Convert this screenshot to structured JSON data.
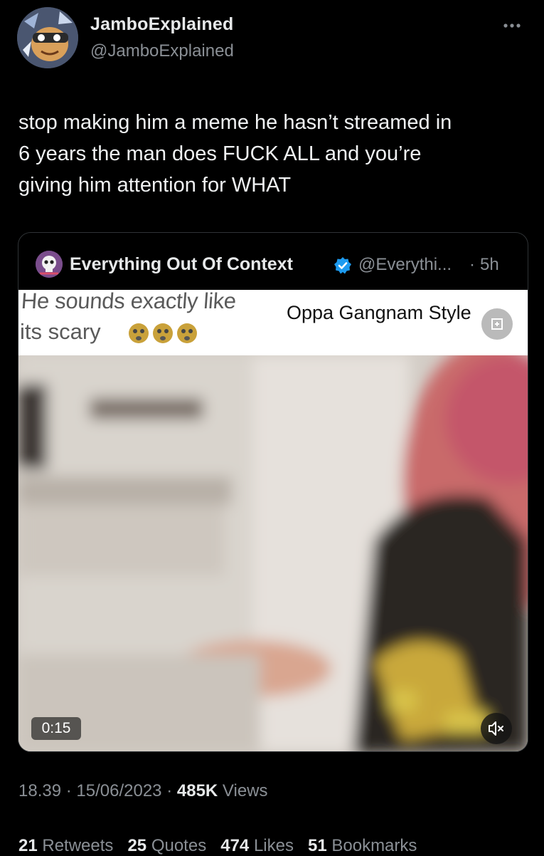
{
  "author": {
    "name": "JamboExplained",
    "handle": "@JamboExplained",
    "avatar_icon": "cartoon-avatar"
  },
  "more_icon": "ellipsis-icon",
  "tweet_text": "stop making him a meme he hasn’t streamed in\n6 years the man does FUCK ALL and you’re\ngiving him attention for WHAT",
  "quote": {
    "name": "Everything Out Of Context",
    "handle": "@Everythi...",
    "separator": "·",
    "time": "5h",
    "verified_color": "#1d9bf0",
    "video": {
      "caption_line_1": "He sounds exactly like",
      "caption_line_2": "its scary",
      "caption_right": "Oppa Gangnam Style",
      "duration": "0:15",
      "mute_icon": "speaker-muted-icon",
      "fullscreen_icon": "expand-icon"
    }
  },
  "meta": {
    "time": "18.39",
    "date": "15/06/2023",
    "sep": "·",
    "views_count": "485K",
    "views_label": "Views"
  },
  "stats": {
    "retweets_count": "21",
    "retweets_label": "Retweets",
    "quotes_count": "25",
    "quotes_label": "Quotes",
    "likes_count": "474",
    "likes_label": "Likes",
    "bookmarks_count": "51",
    "bookmarks_label": "Bookmarks"
  },
  "colors": {
    "background": "#000000",
    "text_primary": "#e7e9ea",
    "text_secondary": "#8a8f95",
    "border": "#2f3336"
  }
}
